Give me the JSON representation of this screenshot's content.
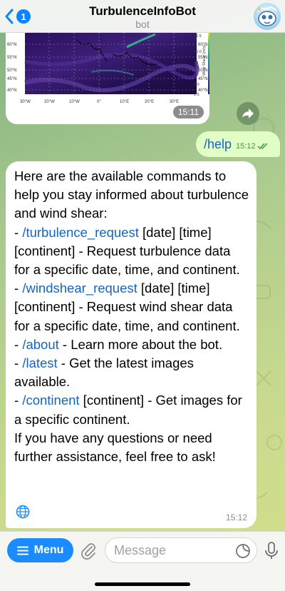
{
  "header": {
    "back_count": "1",
    "title": "TurbulenceInfoBot",
    "subtitle": "bot"
  },
  "image_message": {
    "time": "15:11",
    "lat_labels_left": [
      "60°N",
      "55°N",
      "50°N",
      "45°N",
      "40°N"
    ],
    "lat_labels_right": [
      "60°N",
      "55°N",
      "50°N",
      "45°N",
      "40°N"
    ],
    "lon_labels": [
      "30°W",
      "20°W",
      "10°W",
      "0°",
      "10°E",
      "20°E",
      "30°E"
    ],
    "colorbar_ticks": [
      "12.5",
      "10.0",
      "7.5",
      "5.0",
      "2.5"
    ],
    "colorbar_label": "Wind Shear (m/s)"
  },
  "outgoing": {
    "text": "/help",
    "time": "15:12"
  },
  "incoming": {
    "intro": "Here are the available commands to help you stay informed about turbulence and wind shear:",
    "commands": [
      {
        "prefix": "- ",
        "cmd": "/turbulence_request",
        "desc": " [date] [time] [continent] - Request turbulence data for a specific date, time, and continent."
      },
      {
        "prefix": "- ",
        "cmd": "/windshear_request",
        "desc": " [date] [time] [continent] - Request wind shear data for a specific date, time, and continent."
      },
      {
        "prefix": "- ",
        "cmd": "/about",
        "desc": " - Learn more about the bot."
      },
      {
        "prefix": "- ",
        "cmd": "/latest",
        "desc": " - Get the latest images available."
      },
      {
        "prefix": "- ",
        "cmd": "/continent",
        "desc": " [continent] - Get images for a specific continent."
      }
    ],
    "outro": "If you have any questions or need further assistance, feel free to ask!",
    "time": "15:12"
  },
  "input_bar": {
    "menu_label": "Menu",
    "placeholder": "Message"
  },
  "colors": {
    "accent": "#1a8cff",
    "link": "#1565c0",
    "outgoing_bubble": "#e1fec6",
    "incoming_bubble": "#ffffff"
  },
  "icons": [
    "chevron-left-icon",
    "globe-icon",
    "forward-icon",
    "paperclip-icon",
    "sticker-icon",
    "microphone-icon",
    "double-check-icon",
    "menu-lines-icon"
  ]
}
